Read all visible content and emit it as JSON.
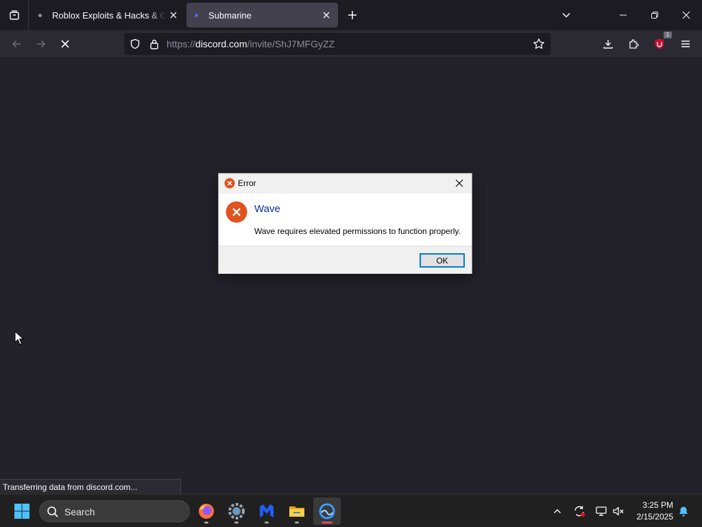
{
  "browser": {
    "tabs": [
      {
        "title": "Roblox Exploits & Hacks & Cheats",
        "active": false
      },
      {
        "title": "Submarine",
        "active": true
      }
    ],
    "url_scheme": "https://",
    "url_host": "discord.com",
    "url_path": "/invite/ShJ7MFGyZZ",
    "extension_badge": "1",
    "status_text": "Transferring data from discord.com...",
    "colors": {
      "accent_tab_dot": "#5865f2",
      "extension": "#c8102e"
    }
  },
  "dialog": {
    "window_title": "Error",
    "heading": "Wave",
    "message": "Wave requires elevated permissions to function properly.",
    "ok_label": "OK",
    "icon": "error-icon",
    "colors": {
      "error": "#e0531f",
      "heading": "#003399"
    }
  },
  "taskbar": {
    "search_label": "Search",
    "pinned_apps": [
      "firefox-icon",
      "settings-icon",
      "malwarebytes-icon",
      "file-explorer-icon",
      "wave-app-icon"
    ],
    "active_app": "wave-app-icon",
    "clock_time": "3:25 PM",
    "clock_date": "2/15/2025"
  }
}
